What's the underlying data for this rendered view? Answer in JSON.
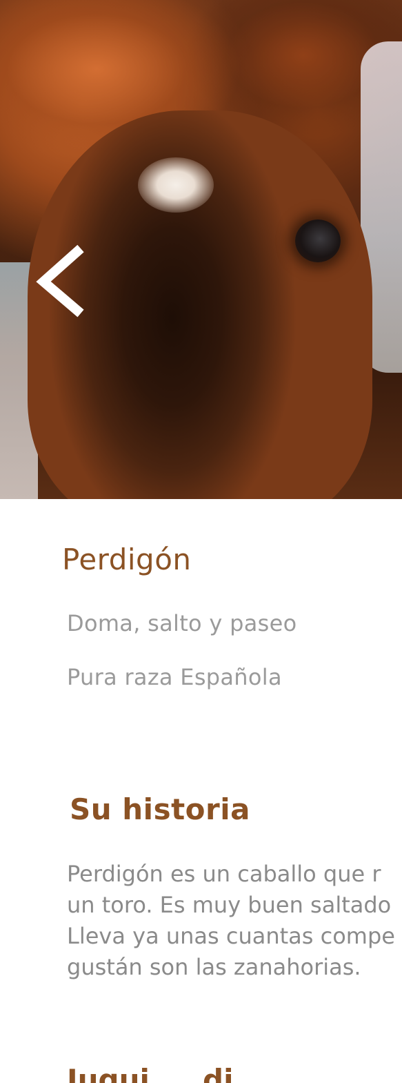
{
  "hero": {
    "image_icon": "horse-photo",
    "back_icon": "chevron-left-icon"
  },
  "horse": {
    "name": "Perdigón",
    "disciplines": "Doma, salto y paseo",
    "breed": "Pura raza Española"
  },
  "history": {
    "title": "Su historia",
    "lines": [
      "Perdigón es un caballo que r",
      "un toro. Es muy buen saltado",
      "Lleva ya unas cuantas compe",
      "gustán son las zanahorias."
    ]
  },
  "next_section": {
    "title_partial": "Jugui ... di"
  },
  "colors": {
    "accent": "#8b5224",
    "muted_text": "#9a9a9a"
  }
}
